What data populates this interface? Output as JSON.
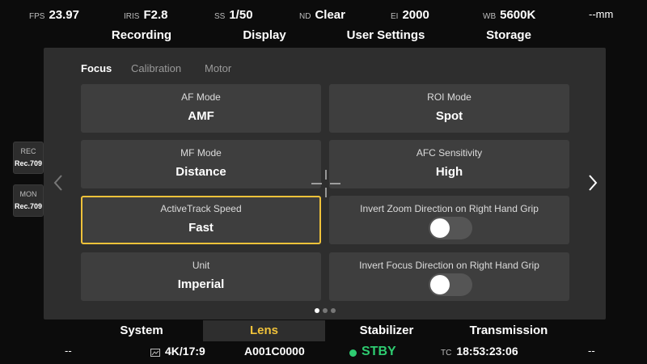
{
  "status_bar": {
    "fps": {
      "label": "FPS",
      "value": "23.97"
    },
    "iris": {
      "label": "IRIS",
      "value": "F2.8"
    },
    "ss": {
      "label": "SS",
      "value": "1/50"
    },
    "nd": {
      "label": "ND",
      "value": "Clear"
    },
    "ei": {
      "label": "EI",
      "value": "2000"
    },
    "wb": {
      "label": "WB",
      "value": "5600K"
    },
    "focal": "--mm"
  },
  "top_menu": [
    "Recording",
    "Display",
    "User Settings",
    "Storage"
  ],
  "side": {
    "rec": {
      "label": "REC",
      "value": "Rec.709"
    },
    "mon": {
      "label": "MON",
      "value": "Rec.709"
    }
  },
  "tabs": [
    "Focus",
    "Calibration",
    "Motor"
  ],
  "active_tab": "Focus",
  "cards": {
    "af_mode": {
      "title": "AF Mode",
      "value": "AMF"
    },
    "roi_mode": {
      "title": "ROI Mode",
      "value": "Spot"
    },
    "mf_mode": {
      "title": "MF Mode",
      "value": "Distance"
    },
    "afc_sensitivity": {
      "title": "AFC Sensitivity",
      "value": "High"
    },
    "activetrack_speed": {
      "title": "ActiveTrack Speed",
      "value": "Fast"
    },
    "invert_zoom": {
      "title": "Invert Zoom Direction on Right Hand Grip",
      "enabled": false
    },
    "unit": {
      "title": "Unit",
      "value": "Imperial"
    },
    "invert_focus": {
      "title": "Invert Focus Direction on Right Hand Grip",
      "enabled": false
    }
  },
  "pagination": {
    "current": 1,
    "total": 3
  },
  "bottom_menu": [
    "System",
    "Lens",
    "Stabilizer",
    "Transmission"
  ],
  "active_bottom": "Lens",
  "bottom_status": {
    "left": "--",
    "resolution": "4K/17:9",
    "clip": "A001C0000",
    "state": "STBY",
    "tc_label": "TC",
    "timecode": "18:53:23:06",
    "right": "--"
  },
  "colors": {
    "accent": "#f0c23a",
    "standby": "#2ecc71",
    "panel": "#2e2e2e",
    "card": "#3e3e3e"
  },
  "icons": [
    "chevron-left-icon",
    "chevron-right-icon",
    "crosshair-icon",
    "monitor-icon",
    "status-dot-icon"
  ]
}
